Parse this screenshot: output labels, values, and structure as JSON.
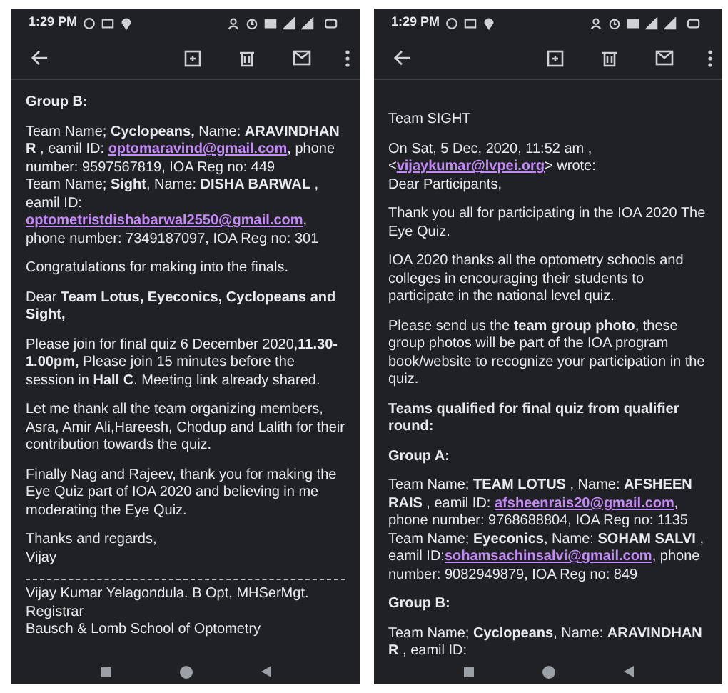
{
  "phones": [
    {
      "status_bar": {
        "time": "1:29 PM"
      },
      "paragraphs": [
        {
          "kind": "heading",
          "lines": [
            [
              {
                "kind": "text",
                "text": "Group B:"
              }
            ]
          ]
        },
        {
          "kind": "text",
          "lines": [
            [
              {
                "kind": "text",
                "text": "Team Name; **Cyclopeans,**  Name: **ARAVINDHAN R** , eamil ID: "
              },
              {
                "kind": "link",
                "text": "optomaravind@gmail.com"
              },
              {
                "kind": "text",
                "text": ", phone number: 9597567819, IOA Reg no: 449"
              }
            ],
            [
              {
                "kind": "text",
                "text": "Team Name; **Sight**,  Name: **DISHA BARWAL** , eamil ID: "
              },
              {
                "kind": "link",
                "text": "optometristdishabarwal2550@gmail.com"
              },
              {
                "kind": "text",
                "text": ", phone number: 7349187097, IOA Reg no: 301"
              }
            ]
          ]
        },
        {
          "kind": "text",
          "lines": [
            [
              {
                "kind": "text",
                "text": "Congratulations for making into the finals."
              }
            ]
          ]
        },
        {
          "kind": "text",
          "lines": [
            [
              {
                "kind": "text",
                "text": "Dear **Team Lotus, Eyeconics, Cyclopeans and Sight,**"
              }
            ]
          ]
        },
        {
          "kind": "text",
          "lines": [
            [
              {
                "kind": "text",
                "text": "Please join for final quiz 6 December 2020,**11.30- 1.00pm,** Please join 15 minutes before the session in **Hall C**. Meeting link already shared."
              }
            ]
          ]
        },
        {
          "kind": "text",
          "lines": [
            [
              {
                "kind": "text",
                "text": "Let me thank all the team organizing members, Asra, Amir Ali,Hareesh, Chodup and Lalith for their contribution towards the quiz."
              }
            ]
          ]
        },
        {
          "kind": "text",
          "lines": [
            [
              {
                "kind": "text",
                "text": "Finally Nag and Rajeev, thank you for making the Eye Quiz part of IOA 2020 and believing in me moderating the Eye Quiz."
              }
            ]
          ]
        },
        {
          "kind": "text",
          "lines": [
            [
              {
                "kind": "text",
                "text": "Thanks and regards,"
              }
            ],
            [
              {
                "kind": "text",
                "text": "Vijay"
              }
            ]
          ]
        },
        {
          "kind": "divider"
        },
        {
          "kind": "text",
          "lines": [
            [
              {
                "kind": "text",
                "text": "Vijay Kumar Yelagondula. B Opt, MHSerMgt."
              }
            ],
            [
              {
                "kind": "text",
                "text": "Registrar"
              }
            ],
            [
              {
                "kind": "text",
                "text": "Bausch & Lomb School of Optometry"
              }
            ]
          ]
        }
      ]
    },
    {
      "status_bar": {
        "time": "1:29 PM"
      },
      "paragraphs": [
        {
          "kind": "text",
          "lines": [
            [
              {
                "kind": "text",
                "text": "Team SIGHT"
              }
            ]
          ]
        },
        {
          "kind": "text",
          "lines": [
            [
              {
                "kind": "text",
                "text": "On Sat, 5 Dec, 2020, 11:52 am ,"
              }
            ],
            [
              {
                "kind": "text",
                "text": "<"
              },
              {
                "kind": "link",
                "text": "vijaykumar@lvpei.org"
              },
              {
                "kind": "text",
                "text": "> wrote:"
              }
            ],
            [
              {
                "kind": "text",
                "text": "Dear Participants,"
              }
            ]
          ]
        },
        {
          "kind": "text",
          "lines": [
            [
              {
                "kind": "text",
                "text": "Thank you all for participating in the IOA 2020 The Eye Quiz."
              }
            ]
          ]
        },
        {
          "kind": "text",
          "lines": [
            [
              {
                "kind": "text",
                "text": "IOA 2020 thanks all the optometry schools and colleges  in encouraging their students to participate in the national level quiz."
              }
            ]
          ]
        },
        {
          "kind": "text",
          "lines": [
            [
              {
                "kind": "text",
                "text": "Please send us the **team group photo**, these group photos will be part of the IOA program book/website to recognize your participation in the quiz."
              }
            ]
          ]
        },
        {
          "kind": "heading",
          "lines": [
            [
              {
                "kind": "text",
                "text": "Teams qualified for final quiz from qualifier round:"
              }
            ]
          ]
        },
        {
          "kind": "heading",
          "lines": [
            [
              {
                "kind": "text",
                "text": "Group A:"
              }
            ]
          ]
        },
        {
          "kind": "text",
          "lines": [
            [
              {
                "kind": "text",
                "text": "Team Name; **TEAM LOTUS** ,  Name: **AFSHEEN RAIS**  , eamil ID: "
              },
              {
                "kind": "link",
                "text": "afsheenrais20@gmail.com"
              },
              {
                "kind": "text",
                "text": ", phone number: 9768688804, IOA Reg no: 1135"
              }
            ],
            [
              {
                "kind": "text",
                "text": "Team Name; **Eyeconics**,  Name: **SOHAM SALVI** , eamil ID:"
              },
              {
                "kind": "link",
                "text": "sohamsachinsalvi@gmail.com"
              },
              {
                "kind": "text",
                "text": ", phone number: 9082949879, IOA Reg no: 849"
              }
            ]
          ]
        },
        {
          "kind": "heading",
          "lines": [
            [
              {
                "kind": "text",
                "text": "Group B:"
              }
            ]
          ]
        },
        {
          "kind": "text",
          "lines": [
            [
              {
                "kind": "text",
                "text": "Team Name; **Cyclopeans**,  Name: **ARAVINDHAN R** , eamil ID:"
              }
            ]
          ]
        }
      ]
    }
  ]
}
